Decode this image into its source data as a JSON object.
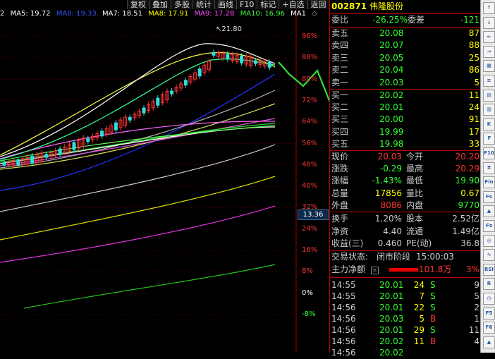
{
  "toolbar": {
    "buttons": [
      "复权",
      "叠加",
      "多股",
      "统计",
      "画线",
      "F10",
      "标记",
      "+自选",
      "返回"
    ]
  },
  "ma_legend": [
    {
      "label": "2",
      "color": "#ffffff"
    },
    {
      "label": "MA5: 19.72",
      "color": "#ffffff"
    },
    {
      "label": "MA6: 19.33",
      "color": "#3355ff"
    },
    {
      "label": "MA7: 18.51",
      "color": "#ffffff"
    },
    {
      "label": "MA8: 17.91",
      "color": "#ffff00"
    },
    {
      "label": "MA9: 17.28",
      "color": "#ff44ff"
    },
    {
      "label": "MA10: 16.96",
      "color": "#44ff44"
    },
    {
      "label": "MA1",
      "color": "#ffffff"
    }
  ],
  "chart": {
    "high_label": "21.80",
    "current_price_tag": "13.36",
    "pct_axis": [
      {
        "label": "96%",
        "color": "#ff3333"
      },
      {
        "label": "88%",
        "color": "#ff3333"
      },
      {
        "label": "80%",
        "color": "#ff3333"
      },
      {
        "label": "72%",
        "color": "#ff3333"
      },
      {
        "label": "64%",
        "color": "#ff3333"
      },
      {
        "label": "56%",
        "color": "#ff3333"
      },
      {
        "label": "48%",
        "color": "#ff3333"
      },
      {
        "label": "40%",
        "color": "#ff3333"
      },
      {
        "label": "32%",
        "color": "#ff3333"
      },
      {
        "label": "24%",
        "color": "#ff3333"
      },
      {
        "label": "16%",
        "color": "#ff3333"
      },
      {
        "label": "8%",
        "color": "#ff3333"
      },
      {
        "label": "0%",
        "color": "#ffffff"
      },
      {
        "label": "-8%",
        "color": "#33ff33"
      }
    ]
  },
  "quote": {
    "code": "002871",
    "name": "伟隆股份",
    "weibi_label": "委比",
    "weibi_value": "-26.25%",
    "weicha_label": "委差",
    "weicha_value": "-121",
    "sell": [
      {
        "label": "卖五",
        "price": "20.08",
        "vol": "87"
      },
      {
        "label": "卖四",
        "price": "20.07",
        "vol": "88"
      },
      {
        "label": "卖三",
        "price": "20.05",
        "vol": "25"
      },
      {
        "label": "卖二",
        "price": "20.04",
        "vol": "86"
      },
      {
        "label": "卖一",
        "price": "20.03",
        "vol": "5"
      }
    ],
    "buy": [
      {
        "label": "买一",
        "price": "20.02",
        "vol": "11"
      },
      {
        "label": "买二",
        "price": "20.01",
        "vol": "24"
      },
      {
        "label": "买三",
        "price": "20.00",
        "vol": "91"
      },
      {
        "label": "买四",
        "price": "19.99",
        "vol": "17"
      },
      {
        "label": "买五",
        "price": "19.98",
        "vol": "33"
      }
    ],
    "stats": [
      {
        "l1": "现价",
        "v1": "20.03",
        "c1": "#ff3333",
        "l2": "今开",
        "v2": "20.20",
        "c2": "#ff3333"
      },
      {
        "l1": "涨跌",
        "v1": "-0.29",
        "c1": "#33ff33",
        "l2": "最高",
        "v2": "20.29",
        "c2": "#ff3333"
      },
      {
        "l1": "涨幅",
        "v1": "-1.43%",
        "c1": "#33ff33",
        "l2": "最低",
        "v2": "19.90",
        "c2": "#33ff33"
      },
      {
        "l1": "总量",
        "v1": "17856",
        "c1": "#ffff00",
        "l2": "量比",
        "v2": "0.67",
        "c2": "#ffff00"
      },
      {
        "l1": "外盘",
        "v1": "8086",
        "c1": "#ff3333",
        "l2": "内盘",
        "v2": "9770",
        "c2": "#33ff33"
      }
    ],
    "stats2": [
      {
        "l1": "换手",
        "v1": "1.20%",
        "l2": "股本",
        "v2": "2.52亿"
      },
      {
        "l1": "净资",
        "v1": "4.40",
        "l2": "流通",
        "v2": "1.49亿"
      },
      {
        "l1": "收益(三)",
        "v1": "0.460",
        "l2": "PE(动)",
        "v2": "36.8"
      }
    ],
    "status_label": "交易状态:",
    "status_value": "闭市阶段",
    "status_time": "15:00:03",
    "main_flow_label": "主力净额",
    "main_flow_value": "101.8万",
    "main_flow_pct": "3%",
    "main_flow_fill": 0.45,
    "ticks": [
      {
        "time": "14:55",
        "price": "20.01",
        "pc": "#33ff33",
        "vol": "24",
        "side": "S",
        "sc": "#33ff33",
        "n": "9"
      },
      {
        "time": "14:55",
        "price": "20.01",
        "pc": "#33ff33",
        "vol": "7",
        "side": "S",
        "sc": "#33ff33",
        "n": "5"
      },
      {
        "time": "14:56",
        "price": "20.01",
        "pc": "#33ff33",
        "vol": "22",
        "side": "S",
        "sc": "#33ff33",
        "n": "2"
      },
      {
        "time": "14:56",
        "price": "20.03",
        "pc": "#33ff33",
        "vol": "5",
        "side": "B",
        "sc": "#ff3333",
        "n": "1"
      },
      {
        "time": "14:56",
        "price": "20.01",
        "pc": "#33ff33",
        "vol": "29",
        "side": "S",
        "sc": "#33ff33",
        "n": "11"
      },
      {
        "time": "14:56",
        "price": "20.02",
        "pc": "#33ff33",
        "vol": "11",
        "side": "B",
        "sc": "#ff3333",
        "n": "4"
      },
      {
        "time": "14:56",
        "price": "20.02",
        "pc": "#33ff33",
        "vol": "",
        "side": "",
        "sc": "#33ff33",
        "n": ""
      }
    ]
  },
  "sidebar": {
    "icons": [
      "arrow-up-icon",
      "arrow-down-icon",
      "arrow-left-icon",
      "arrow-right-icon",
      "grid-icon",
      "list-icon",
      "chart-icon",
      "table-icon",
      "candle-icon",
      "fund-icon",
      "f10-icon",
      "money-icon",
      "fin-icon",
      "fenshi-icon",
      "kline-icon",
      "fz-icon",
      "tick-icon",
      "rsi-icon",
      "r-icon",
      "clock-icon",
      "f5-icon",
      "f6-icon",
      "up-icon",
      "down-icon"
    ],
    "labels": [
      "↑",
      "↓",
      "←",
      "→",
      "▦",
      "≡",
      "▤",
      "▥",
      "K",
      "₣",
      "F10",
      "¥",
      "Fin",
      "Fs",
      "▲",
      "Fz",
      "◎",
      "∿",
      "RSI",
      "R",
      "◷",
      "F5",
      "F6",
      "▲"
    ]
  }
}
